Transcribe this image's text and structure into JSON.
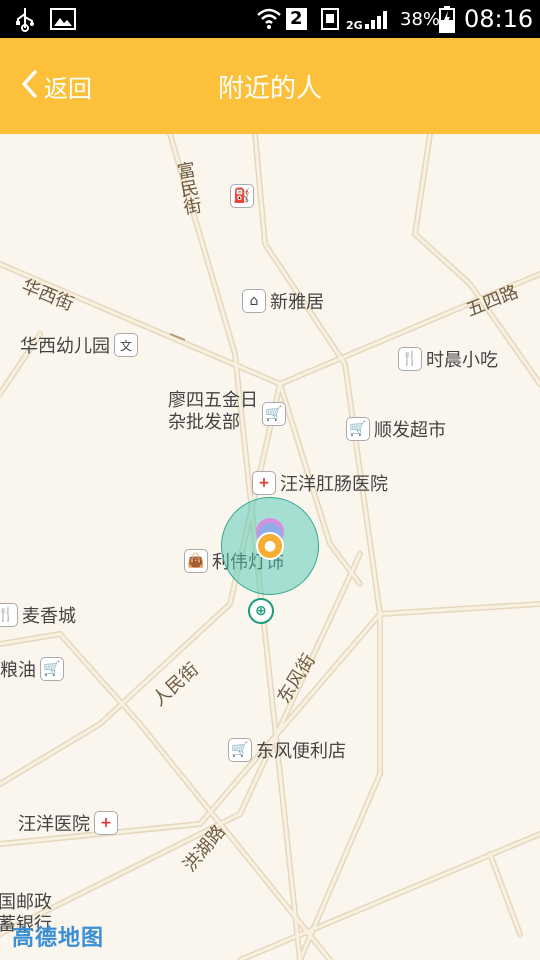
{
  "status_bar": {
    "sim": "2",
    "network": "2G",
    "battery": "38%",
    "time": "08:16"
  },
  "app_bar": {
    "back_label": "返回",
    "title": "附近的人"
  },
  "map": {
    "pois": [
      {
        "name": "新雅居"
      },
      {
        "name": "华西幼儿园"
      },
      {
        "name": "时晨小吃"
      },
      {
        "name_line1": "廖四五金日",
        "name_line2": "杂批发部"
      },
      {
        "name": "顺发超市"
      },
      {
        "name": "汪洋肛肠医院"
      },
      {
        "name": "利伟灯饰"
      },
      {
        "name": "麦香城"
      },
      {
        "name": "粮油"
      },
      {
        "name": "东风便利店"
      },
      {
        "name": "汪洋医院"
      },
      {
        "name": "国邮政"
      },
      {
        "name": "蓄银行"
      }
    ],
    "roads": [
      "富民街",
      "华西街",
      "五四路",
      "人民街",
      "东风街",
      "洪湖路"
    ],
    "logo": "高德地图"
  }
}
